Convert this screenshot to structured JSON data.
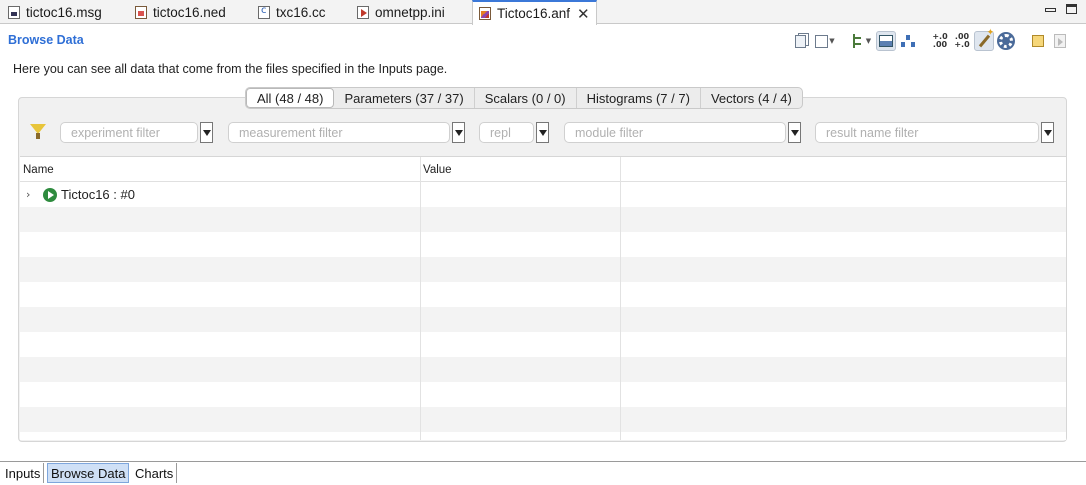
{
  "editor_tabs": [
    {
      "label": "tictoc16.msg",
      "icon": "msg-file-icon"
    },
    {
      "label": "tictoc16.ned",
      "icon": "ned-file-icon"
    },
    {
      "label": "txc16.cc",
      "icon": "cc-file-icon"
    },
    {
      "label": "omnetpp.ini",
      "icon": "ini-file-icon"
    },
    {
      "label": "Tictoc16.anf",
      "icon": "anf-file-icon",
      "active": true
    }
  ],
  "page": {
    "title": "Browse Data",
    "description": "Here you can see all data that come from the files specified in the Inputs page."
  },
  "toolbar_icons": [
    "copy-icon",
    "export-icon",
    "tree-mode-icon",
    "table-mode-icon",
    "hierarchy-icon",
    "increase-decimals-icon",
    "decrease-decimals-icon",
    "magic-wand-icon",
    "gear-icon",
    "pin-icon",
    "forward-icon"
  ],
  "result_tabs": [
    {
      "label": "All (48 / 48)",
      "active": true
    },
    {
      "label": "Parameters (37 / 37)"
    },
    {
      "label": "Scalars (0 / 0)"
    },
    {
      "label": "Histograms (7 / 7)"
    },
    {
      "label": "Vectors (4 / 4)"
    }
  ],
  "filters": {
    "experiment": "experiment filter",
    "measurement": "measurement filter",
    "replication": "repl",
    "module": "module filter",
    "result_name": "result name filter"
  },
  "table": {
    "columns": [
      "Name",
      "Value"
    ],
    "rows": [
      {
        "name": "Tictoc16 : #0",
        "value": ""
      }
    ]
  },
  "bottom_tabs": [
    {
      "label": "Inputs"
    },
    {
      "label": "Browse Data",
      "active": true
    },
    {
      "label": "Charts"
    }
  ],
  "colors": {
    "accent": "#2f6fd6",
    "run_icon": "#2e8b3e",
    "active_page_tab": "#cfe0f6"
  }
}
